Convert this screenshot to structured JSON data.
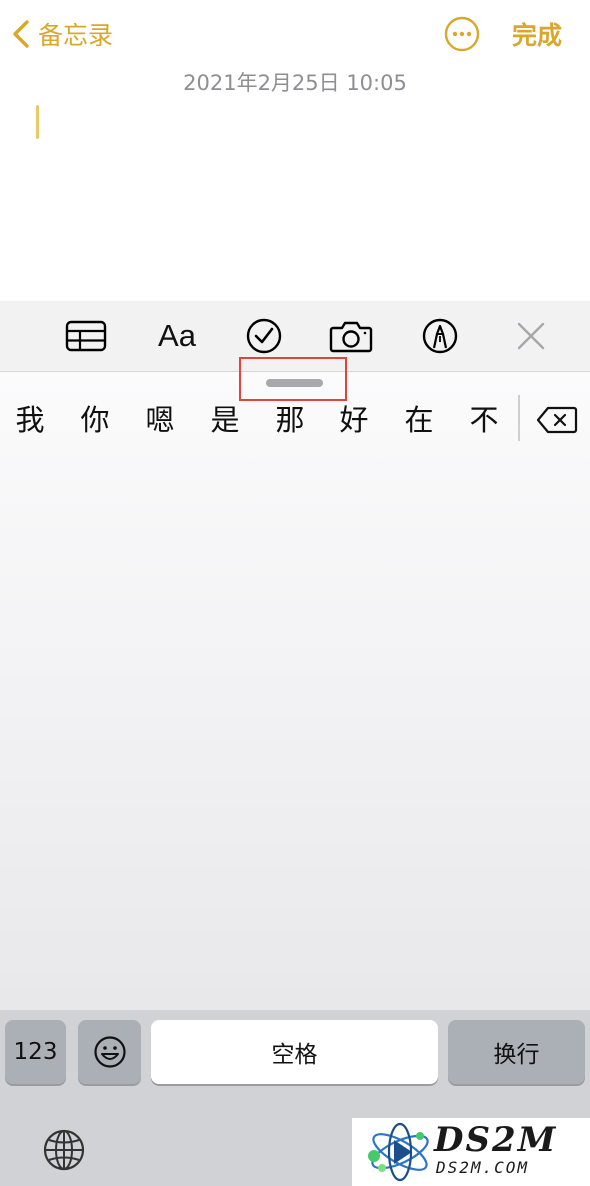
{
  "nav": {
    "back_label": "备忘录",
    "done_label": "完成"
  },
  "note": {
    "timestamp": "2021年2月25日 10:05"
  },
  "toolbar": {
    "items": [
      "table-icon",
      "format-text",
      "checklist-icon",
      "camera-icon",
      "markup-icon",
      "close-icon"
    ],
    "format_label": "Aa"
  },
  "keyboard": {
    "candidates": [
      "我",
      "你",
      "嗯",
      "是",
      "那",
      "好",
      "在",
      "不"
    ],
    "numbers_key": "123",
    "space_key": "空格",
    "return_key": "换行"
  },
  "watermark": {
    "big": "DS2M",
    "small": "DS2M.COM"
  },
  "colors": {
    "accent": "#d9a82b",
    "highlight_box": "#e0443e"
  }
}
